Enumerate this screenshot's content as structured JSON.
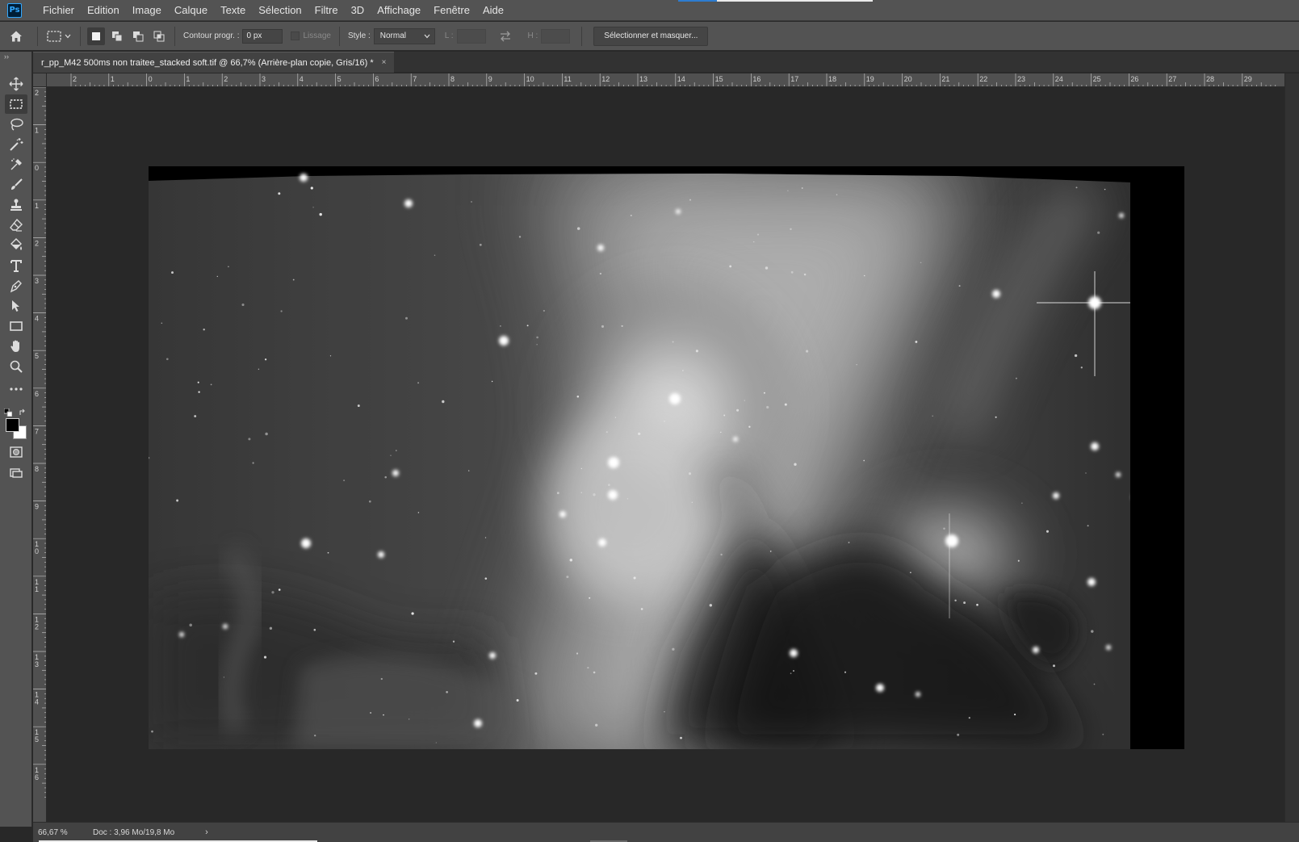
{
  "app": {
    "logo_text": "Ps",
    "menus": [
      "Fichier",
      "Edition",
      "Image",
      "Calque",
      "Texte",
      "Sélection",
      "Filtre",
      "3D",
      "Affichage",
      "Fenêtre",
      "Aide"
    ]
  },
  "options": {
    "feather_label": "Contour progr. :",
    "feather_value": "0 px",
    "antialias_label": "Lissage",
    "style_label": "Style :",
    "style_value": "Normal",
    "width_label": "L :",
    "height_label": "H :",
    "select_mask_label": "Sélectionner et masquer..."
  },
  "toolbar": {
    "grip": "››",
    "tools": [
      "move-tool",
      "marquee-tool",
      "lasso-tool",
      "magic-wand-tool",
      "eyedropper-tool",
      "brush-tool",
      "stamp-tool",
      "eraser-tool",
      "paint-bucket-tool",
      "type-tool",
      "pen-tool",
      "path-select-tool",
      "rectangle-tool",
      "hand-tool",
      "zoom-tool",
      "more-tools",
      "quick-mask",
      "screen-mode"
    ],
    "active_tool": "marquee-tool",
    "foreground_color": "#000000",
    "background_color": "#ffffff"
  },
  "document": {
    "tab_title": "r_pp_M42 500ms non traitee_stacked soft.tif @ 66,7% (Arrière-plan copie, Gris/16) *",
    "close": "×"
  },
  "rulers": {
    "top_labels": [
      "2",
      "1",
      "0",
      "1",
      "2",
      "3",
      "4",
      "5",
      "6",
      "7",
      "8",
      "9",
      "10",
      "11",
      "12",
      "13",
      "14",
      "15",
      "16",
      "17",
      "18",
      "19",
      "20",
      "21",
      "22",
      "23",
      "24",
      "25",
      "26",
      "27",
      "28",
      "29"
    ],
    "left_labels": [
      "2",
      "1",
      "0",
      "1",
      "2",
      "3",
      "4",
      "5",
      "6",
      "7",
      "8",
      "9",
      "10",
      "11",
      "12",
      "13",
      "14",
      "15",
      "16"
    ]
  },
  "status": {
    "zoom": "66,67 %",
    "doc_info": "Doc : 3,96 Mo/19,8 Mo",
    "arrow": "›"
  },
  "image": {
    "subject": "nebula-astrophoto",
    "mode": "grayscale"
  }
}
